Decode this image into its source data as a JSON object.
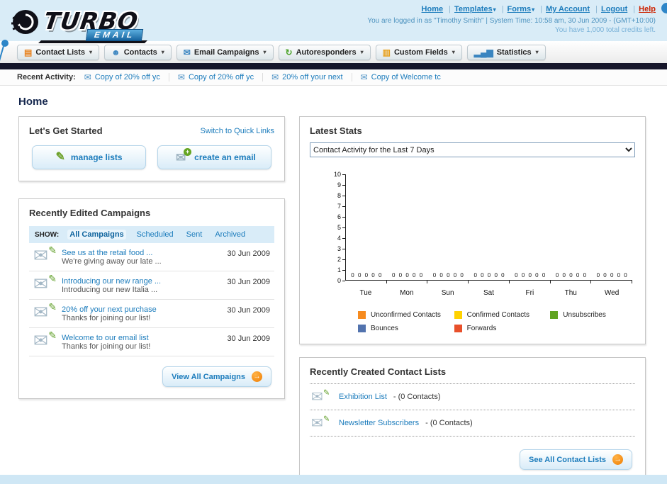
{
  "icons": {
    "envelope": "✉",
    "pencil": "✎",
    "caret": "▾",
    "plus": "+",
    "arrow": "→",
    "person": "☻",
    "list": "▤",
    "refresh": "↻",
    "field": "▥",
    "stats_bars": "▂▄▆"
  },
  "header": {
    "logo_text": "TURBO",
    "logo_sub": "EMAIL",
    "links": [
      {
        "label": "Home",
        "dropdown": false
      },
      {
        "label": "Templates",
        "dropdown": true
      },
      {
        "label": "Forms",
        "dropdown": true
      },
      {
        "label": "My Account",
        "dropdown": false
      },
      {
        "label": "Logout",
        "dropdown": false
      },
      {
        "label": "Help",
        "dropdown": false
      }
    ],
    "login_info": "You are logged in as \"Timothy Smith\" | System Time: 10:58 am, 30 Jun 2009 - (GMT+10:00)",
    "credits_info": "You have 1,000 total credits left."
  },
  "nav_tabs": [
    {
      "label": "Contact Lists"
    },
    {
      "label": "Contacts"
    },
    {
      "label": "Email Campaigns"
    },
    {
      "label": "Autoresponders"
    },
    {
      "label": "Custom Fields"
    },
    {
      "label": "Statistics"
    }
  ],
  "recent_activity": {
    "label": "Recent Activity:",
    "items": [
      {
        "text": "Copy of 20% off yc"
      },
      {
        "text": "Copy of 20% off yc"
      },
      {
        "text": "20% off your next"
      },
      {
        "text": "Copy of Welcome tc"
      }
    ]
  },
  "page": {
    "title": "Home"
  },
  "get_started": {
    "title": "Let's Get Started",
    "switch_link": "Switch to Quick Links",
    "manage_lists_label": "manage lists",
    "create_email_label": "create an email"
  },
  "campaigns": {
    "title": "Recently Edited Campaigns",
    "show_label": "SHOW:",
    "filters": [
      "All Campaigns",
      "Scheduled",
      "Sent",
      "Archived"
    ],
    "items": [
      {
        "title": "See us at the retail food ...",
        "subtitle": "We're giving away our late ...",
        "date": "30 Jun 2009"
      },
      {
        "title": "Introducing our new range ...",
        "subtitle": "Introducing our new Italia ...",
        "date": "30 Jun 2009"
      },
      {
        "title": "20% off your next purchase",
        "subtitle": "Thanks for joining our list!",
        "date": "30 Jun 2009"
      },
      {
        "title": "Welcome to our email list",
        "subtitle": "Thanks for joining our list!",
        "date": "30 Jun 2009"
      }
    ],
    "view_all_label": "View All Campaigns"
  },
  "latest_stats": {
    "title": "Latest Stats",
    "dropdown_value": "Contact Activity for the Last 7 Days",
    "zero_row": "0 0 0 0 0",
    "chart_data": {
      "type": "bar",
      "title": "Contact Activity for the Last 7 Days",
      "categories": [
        "Tue",
        "Mon",
        "Sun",
        "Sat",
        "Fri",
        "Thu",
        "Wed"
      ],
      "series": [
        {
          "name": "Unconfirmed Contacts",
          "color": "#f68b1f",
          "values": [
            0,
            0,
            0,
            0,
            0,
            0,
            0
          ]
        },
        {
          "name": "Confirmed Contacts",
          "color": "#ffd200",
          "values": [
            0,
            0,
            0,
            0,
            0,
            0,
            0
          ]
        },
        {
          "name": "Unsubscribes",
          "color": "#61a421",
          "values": [
            0,
            0,
            0,
            0,
            0,
            0,
            0
          ]
        },
        {
          "name": "Bounces",
          "color": "#5273ae",
          "values": [
            0,
            0,
            0,
            0,
            0,
            0,
            0
          ]
        },
        {
          "name": "Forwards",
          "color": "#e8502b",
          "values": [
            0,
            0,
            0,
            0,
            0,
            0,
            0
          ]
        }
      ],
      "ylim": [
        0,
        10
      ],
      "yticks": [
        "10",
        "9",
        "8",
        "7",
        "6",
        "5",
        "4",
        "3",
        "2",
        "1",
        "0"
      ],
      "grid": false,
      "legend_position": "bottom"
    }
  },
  "contact_lists": {
    "title": "Recently Created Contact Lists",
    "items": [
      {
        "name": "Exhibition List",
        "suffix": "- (0 Contacts)"
      },
      {
        "name": "Newsletter Subscribers",
        "suffix": "- (0 Contacts)"
      }
    ],
    "see_all_label": "See All Contact Lists"
  }
}
